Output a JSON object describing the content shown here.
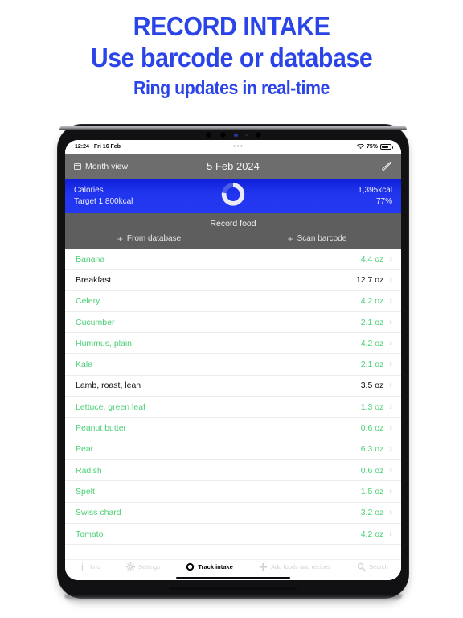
{
  "promo": {
    "line1": "RECORD INTAKE",
    "line2": "Use barcode or database",
    "line3": "Ring updates in real-time",
    "color": "#2a44e8"
  },
  "statusbar": {
    "time": "12:24",
    "date": "Fri 16 Feb",
    "center": "•••",
    "battery_percent": "75%",
    "wifi_icon": "wifi-icon",
    "battery_icon": "battery-icon"
  },
  "navbar": {
    "back_label": "Month view",
    "back_icon": "calendar-icon",
    "title": "5 Feb 2024",
    "edit_icon": "pencil-icon"
  },
  "calories": {
    "label": "Calories",
    "target": "Target 1,800kcal",
    "value": "1,395kcal",
    "percent": "77%",
    "ring_progress": 77,
    "bg_color": "#2236f0"
  },
  "record": {
    "title": "Record food",
    "from_database": "From database",
    "scan_barcode": "Scan barcode",
    "plus_icon": "plus-icon"
  },
  "food_list": [
    {
      "name": "Banana",
      "amount": "4.4 oz",
      "style": "green"
    },
    {
      "name": "Breakfast",
      "amount": "12.7 oz",
      "style": "dark"
    },
    {
      "name": "Celery",
      "amount": "4.2 oz",
      "style": "green"
    },
    {
      "name": "Cucumber",
      "amount": "2.1 oz",
      "style": "green"
    },
    {
      "name": "Hummus, plain",
      "amount": "4.2 oz",
      "style": "green"
    },
    {
      "name": "Kale",
      "amount": "2.1 oz",
      "style": "green"
    },
    {
      "name": "Lamb, roast, lean",
      "amount": "3.5 oz",
      "style": "dark"
    },
    {
      "name": "Lettuce, green leaf",
      "amount": "1.3 oz",
      "style": "green"
    },
    {
      "name": "Peanut butter",
      "amount": "0.6 oz",
      "style": "green"
    },
    {
      "name": "Pear",
      "amount": "6.3 oz",
      "style": "green"
    },
    {
      "name": "Radish",
      "amount": "0.6 oz",
      "style": "green"
    },
    {
      "name": "Spelt",
      "amount": "1.5 oz",
      "style": "green"
    },
    {
      "name": "Swiss chard",
      "amount": "3.2 oz",
      "style": "green"
    },
    {
      "name": "Tomato",
      "amount": "4.2 oz",
      "style": "green"
    }
  ],
  "list_chevron": "›",
  "green_color": "#4cd077",
  "tabs": [
    {
      "label": "Info",
      "icon": "info-icon",
      "active": false
    },
    {
      "label": "Settings",
      "icon": "gear-icon",
      "active": false
    },
    {
      "label": "Track intake",
      "icon": "ring-icon",
      "active": true
    },
    {
      "label": "Add foods and recipes",
      "icon": "plus-icon",
      "active": false
    },
    {
      "label": "Search",
      "icon": "search-icon",
      "active": false
    }
  ]
}
